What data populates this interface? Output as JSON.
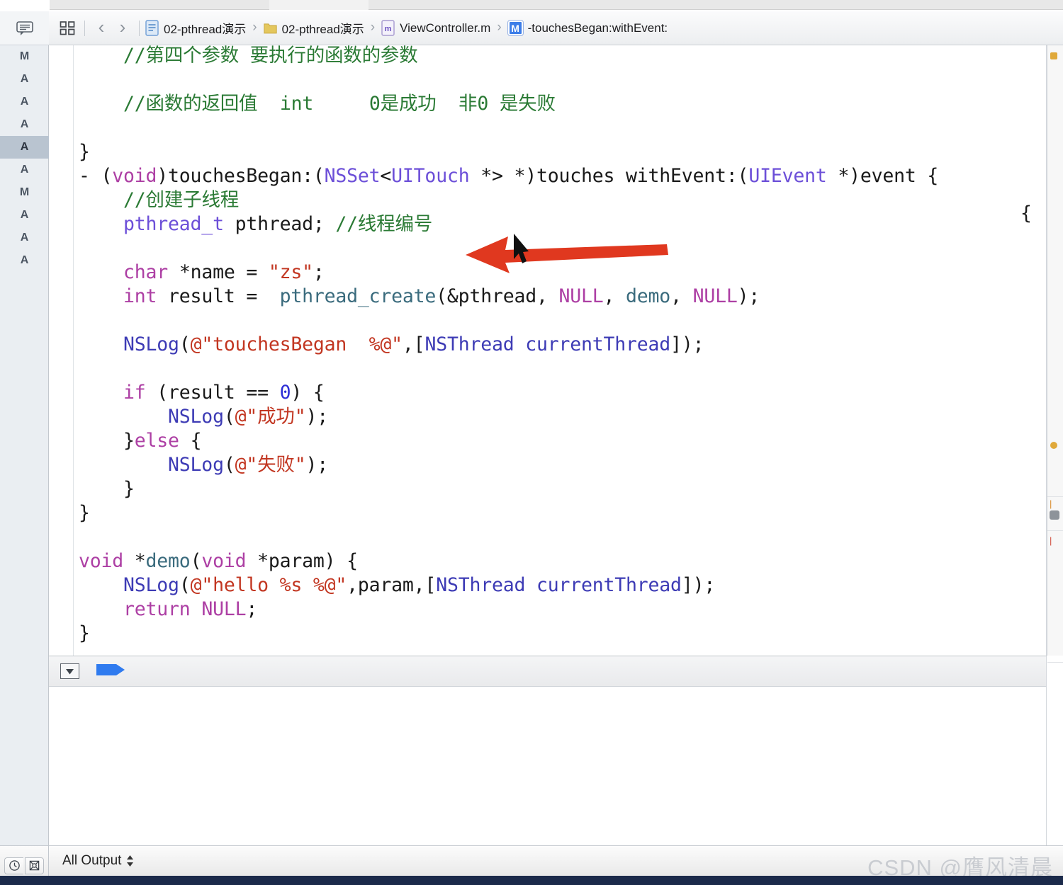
{
  "window": {
    "app": "Xcode",
    "title": "02-pthread演示"
  },
  "navigator": {
    "header_icon": "speech-bubble-icon",
    "change_markers": [
      "M",
      "A",
      "A",
      "A",
      "A",
      "A",
      "M",
      "A",
      "A",
      "A"
    ],
    "selected_index": 4,
    "footer_buttons": [
      "clock-icon",
      "target-icon"
    ]
  },
  "jumpbar": {
    "grid_icon": "grid-icon",
    "back_label": "‹",
    "forward_label": "›",
    "crumbs": [
      {
        "icon": "project-file-icon",
        "label": "02-pthread演示"
      },
      {
        "icon": "folder-icon",
        "label": "02-pthread演示"
      },
      {
        "icon": "m-file-icon",
        "label": "ViewController.m"
      },
      {
        "icon": "method-badge-icon",
        "label": "-touchesBegan:withEvent:"
      }
    ],
    "separator": "›"
  },
  "editor": {
    "language": "objective-c",
    "lines": [
      [
        {
          "t": "    ",
          "c": "pl"
        },
        {
          "t": "//第四个参数 要执行的函数的参数",
          "c": "cm"
        }
      ],
      [],
      [
        {
          "t": "    ",
          "c": "pl"
        },
        {
          "t": "//函数的返回值  int     0是成功  非0 是失败",
          "c": "cm"
        }
      ],
      [],
      [
        {
          "t": "}",
          "c": "pl"
        }
      ],
      [
        {
          "t": "- (",
          "c": "pl"
        },
        {
          "t": "void",
          "c": "kw"
        },
        {
          "t": ")touchesBegan:(",
          "c": "pl"
        },
        {
          "t": "NSSet",
          "c": "ty"
        },
        {
          "t": "<",
          "c": "pl"
        },
        {
          "t": "UITouch",
          "c": "ty"
        },
        {
          "t": " *> *)touches withEvent:(",
          "c": "pl"
        },
        {
          "t": "UIEvent",
          "c": "ty"
        },
        {
          "t": " *)event {",
          "c": "pl"
        }
      ],
      [
        {
          "t": "    ",
          "c": "pl"
        },
        {
          "t": "//创建子线程",
          "c": "cm"
        }
      ],
      [
        {
          "t": "    ",
          "c": "pl"
        },
        {
          "t": "pthread_t",
          "c": "ty"
        },
        {
          "t": " pthread; ",
          "c": "pl"
        },
        {
          "t": "//线程编号",
          "c": "cm"
        }
      ],
      [],
      [
        {
          "t": "    ",
          "c": "pl"
        },
        {
          "t": "char",
          "c": "kw"
        },
        {
          "t": " *name = ",
          "c": "pl"
        },
        {
          "t": "\"zs\"",
          "c": "str"
        },
        {
          "t": ";",
          "c": "pl"
        }
      ],
      [
        {
          "t": "    ",
          "c": "pl"
        },
        {
          "t": "int",
          "c": "kw"
        },
        {
          "t": " result =  ",
          "c": "pl"
        },
        {
          "t": "pthread_create",
          "c": "fn"
        },
        {
          "t": "(&pthread, ",
          "c": "pl"
        },
        {
          "t": "NULL",
          "c": "kw"
        },
        {
          "t": ", ",
          "c": "pl"
        },
        {
          "t": "demo",
          "c": "fn"
        },
        {
          "t": ", ",
          "c": "pl"
        },
        {
          "t": "NULL",
          "c": "kw"
        },
        {
          "t": ");",
          "c": "pl"
        }
      ],
      [],
      [
        {
          "t": "    ",
          "c": "pl"
        },
        {
          "t": "NSLog",
          "c": "prj"
        },
        {
          "t": "(",
          "c": "pl"
        },
        {
          "t": "@\"touchesBegan  %@\"",
          "c": "str"
        },
        {
          "t": ",[",
          "c": "pl"
        },
        {
          "t": "NSThread",
          "c": "prj"
        },
        {
          "t": " ",
          "c": "pl"
        },
        {
          "t": "currentThread",
          "c": "prj"
        },
        {
          "t": "]);",
          "c": "pl"
        }
      ],
      [],
      [
        {
          "t": "    ",
          "c": "pl"
        },
        {
          "t": "if",
          "c": "kw"
        },
        {
          "t": " (result == ",
          "c": "pl"
        },
        {
          "t": "0",
          "c": "num"
        },
        {
          "t": ") {",
          "c": "pl"
        }
      ],
      [
        {
          "t": "        ",
          "c": "pl"
        },
        {
          "t": "NSLog",
          "c": "prj"
        },
        {
          "t": "(",
          "c": "pl"
        },
        {
          "t": "@\"成功\"",
          "c": "str"
        },
        {
          "t": ");",
          "c": "pl"
        }
      ],
      [
        {
          "t": "    }",
          "c": "pl"
        },
        {
          "t": "else",
          "c": "kw"
        },
        {
          "t": " {",
          "c": "pl"
        }
      ],
      [
        {
          "t": "        ",
          "c": "pl"
        },
        {
          "t": "NSLog",
          "c": "prj"
        },
        {
          "t": "(",
          "c": "pl"
        },
        {
          "t": "@\"失败\"",
          "c": "str"
        },
        {
          "t": ");",
          "c": "pl"
        }
      ],
      [
        {
          "t": "    }",
          "c": "pl"
        }
      ],
      [
        {
          "t": "}",
          "c": "pl"
        }
      ],
      [],
      [
        {
          "t": "void",
          "c": "kw"
        },
        {
          "t": " *",
          "c": "pl"
        },
        {
          "t": "demo",
          "c": "fn"
        },
        {
          "t": "(",
          "c": "pl"
        },
        {
          "t": "void",
          "c": "kw"
        },
        {
          "t": " *param) {",
          "c": "pl"
        }
      ],
      [
        {
          "t": "    ",
          "c": "pl"
        },
        {
          "t": "NSLog",
          "c": "prj"
        },
        {
          "t": "(",
          "c": "pl"
        },
        {
          "t": "@\"hello %s %@\"",
          "c": "str"
        },
        {
          "t": ",param,[",
          "c": "pl"
        },
        {
          "t": "NSThread",
          "c": "prj"
        },
        {
          "t": " ",
          "c": "pl"
        },
        {
          "t": "currentThread",
          "c": "prj"
        },
        {
          "t": "]);",
          "c": "pl"
        }
      ],
      [
        {
          "t": "    ",
          "c": "pl"
        },
        {
          "t": "return",
          "c": "kw"
        },
        {
          "t": " ",
          "c": "pl"
        },
        {
          "t": "NULL",
          "c": "kw"
        },
        {
          "t": ";",
          "c": "pl"
        }
      ],
      [
        {
          "t": "}",
          "c": "pl"
        }
      ]
    ],
    "trailing_brace_right": "{"
  },
  "annotation": {
    "arrow_color": "#e0381f",
    "arrow_direction": "left",
    "cursor": "mouse-pointer"
  },
  "console": {
    "toggle_icon": "chevron-down-box-icon",
    "filter_icon": "blue-tag-icon",
    "output_text": ""
  },
  "statusbar": {
    "output_filter_label": "All Output",
    "stepper_icon": "up-down-stepper-icon"
  },
  "watermark": {
    "prefix": "CSDN @",
    "name": "膺风清晨",
    "highlight_char": "清"
  },
  "colors": {
    "comment": "#2a7a34",
    "keyword": "#ad3fa4",
    "type": "#6c4fd8",
    "string": "#c23621",
    "number": "#2d2fd6",
    "function": "#3a6b7d",
    "project_symbol": "#3d3bb5",
    "accent_blue": "#3c7de8",
    "arrow_red": "#e0381f",
    "selection_gray": "#b9c4d0"
  }
}
